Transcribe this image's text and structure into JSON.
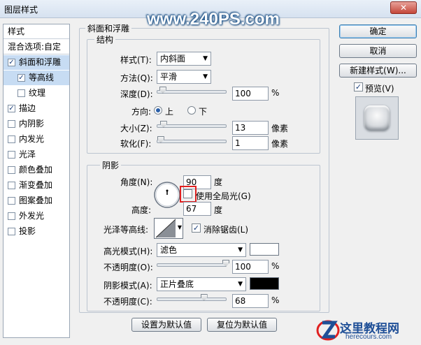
{
  "window": {
    "title": "图层样式",
    "close_symbol": "✕"
  },
  "watermark": "www.240PS.com",
  "left_panel": {
    "header": "样式",
    "blend_options": "混合选项:自定",
    "items": [
      {
        "label": "斜面和浮雕",
        "checked": true,
        "selected": true,
        "indent": false
      },
      {
        "label": "等高线",
        "checked": true,
        "selected": true,
        "indent": true
      },
      {
        "label": "纹理",
        "checked": false,
        "selected": false,
        "indent": true
      },
      {
        "label": "描边",
        "checked": true,
        "selected": false,
        "indent": false
      },
      {
        "label": "内阴影",
        "checked": false,
        "selected": false,
        "indent": false
      },
      {
        "label": "内发光",
        "checked": false,
        "selected": false,
        "indent": false
      },
      {
        "label": "光泽",
        "checked": false,
        "selected": false,
        "indent": false
      },
      {
        "label": "颜色叠加",
        "checked": false,
        "selected": false,
        "indent": false
      },
      {
        "label": "渐变叠加",
        "checked": false,
        "selected": false,
        "indent": false
      },
      {
        "label": "图案叠加",
        "checked": false,
        "selected": false,
        "indent": false
      },
      {
        "label": "外发光",
        "checked": false,
        "selected": false,
        "indent": false
      },
      {
        "label": "投影",
        "checked": false,
        "selected": false,
        "indent": false
      }
    ]
  },
  "bevel": {
    "section_title": "斜面和浮雕",
    "structure_title": "结构",
    "style_label": "样式(T):",
    "style_value": "内斜面",
    "technique_label": "方法(Q):",
    "technique_value": "平滑",
    "depth_label": "深度(D):",
    "depth_value": "100",
    "depth_unit": "%",
    "depth_fraction": 0.08,
    "direction_label": "方向:",
    "direction_up": "上",
    "direction_down": "下",
    "size_label": "大小(Z):",
    "size_value": "13",
    "size_unit": "像素",
    "size_fraction": 0.09,
    "soften_label": "软化(F):",
    "soften_value": "1",
    "soften_unit": "像素",
    "soften_fraction": 0.05
  },
  "shading": {
    "title": "阴影",
    "angle_label": "角度(N):",
    "angle_value": "90",
    "angle_unit": "度",
    "global_light_label": "使用全局光(G)",
    "altitude_label": "高度:",
    "altitude_value": "67",
    "altitude_unit": "度",
    "gloss_label": "光泽等高线:",
    "antialias_label": "消除锯齿(L)",
    "highlight_mode_label": "高光模式(H):",
    "highlight_mode_value": "滤色",
    "highlight_color": "#ffffff",
    "highlight_opacity_label": "不透明度(O):",
    "highlight_opacity_value": "100",
    "highlight_opacity_fraction": 1.0,
    "shadow_mode_label": "阴影模式(A):",
    "shadow_mode_value": "正片叠底",
    "shadow_color": "#000000",
    "shadow_opacity_label": "不透明度(C):",
    "shadow_opacity_value": "68",
    "shadow_opacity_fraction": 0.68,
    "pct": "%"
  },
  "buttons": {
    "ok": "确定",
    "cancel": "取消",
    "new_style": "新建样式(W)...",
    "preview": "预览(V)",
    "make_default": "设置为默认值",
    "reset_default": "复位为默认值"
  },
  "logo": {
    "name": "这里教程网",
    "url": "herecours.com"
  }
}
